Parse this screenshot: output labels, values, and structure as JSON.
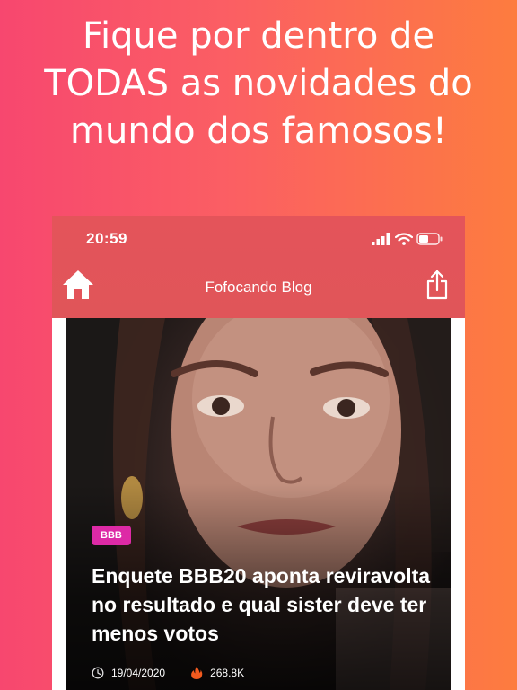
{
  "promo": {
    "line1": "Fique por dentro de",
    "line2": "TODAS as novidades do",
    "line3": "mundo dos famosos!"
  },
  "status_bar": {
    "time": "20:59"
  },
  "app": {
    "title": "Fofocando Blog"
  },
  "article": {
    "category": "BBB",
    "title": "Enquete BBB20 aponta reviravolta no resultado e qual sister deve ter menos votos",
    "date": "19/04/2020",
    "views": "268.8K"
  },
  "colors": {
    "gradient_left": "#f7476f",
    "gradient_right": "#fd7c3f",
    "appbar": "#e4545a",
    "badge": "#dd2aa6",
    "views_icon": "#f25a1e"
  },
  "icons": {
    "home": "home-icon",
    "share": "share-icon",
    "signal": "signal-icon",
    "wifi": "wifi-icon",
    "battery": "battery-icon",
    "clock": "clock-icon",
    "fire": "fire-icon"
  }
}
